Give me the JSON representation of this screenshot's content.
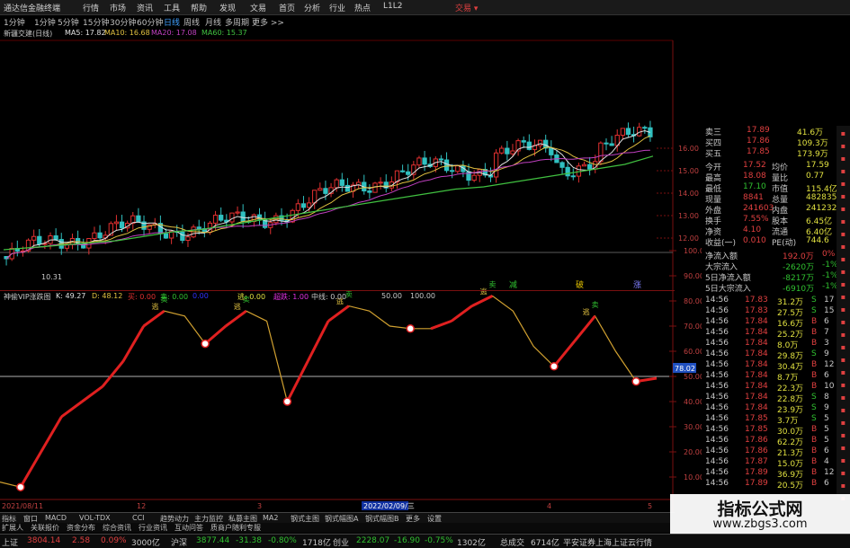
{
  "app": {
    "title": "通达信金融终端",
    "menu": [
      "行情",
      "市场",
      "资讯",
      "工具",
      "帮助",
      "发现",
      "文易",
      "首页",
      "分析",
      "行业",
      "热点",
      "L1L2"
    ],
    "trade_button": "交易 ▾"
  },
  "period_bar": {
    "items": [
      "1分钟",
      "1分钟",
      "5分钟",
      "15分钟",
      "30分钟",
      "60分钟",
      "日线",
      "周线",
      "月线",
      "多周期",
      "更多 >>"
    ],
    "active": "日线"
  },
  "price_chart": {
    "legend": [
      {
        "text": "新疆交建(日线)",
        "color": "#c8c8c8"
      },
      {
        "text": "MA5: 17.82",
        "color": "#e0e0e0"
      },
      {
        "text": "MA10: 16.68",
        "color": "#e0c040"
      },
      {
        "text": "MA20: 17.08",
        "color": "#c040c0"
      },
      {
        "text": "MA60: 15.37",
        "color": "#40c040"
      }
    ],
    "y_ticks": [
      "16.00",
      "15.00",
      "14.00",
      "13.00",
      "12.00"
    ],
    "low_label": "10.31",
    "markers": [
      {
        "label": "减",
        "color": "#30c030"
      },
      {
        "label": "破",
        "color": "#e0c000"
      },
      {
        "label": "涨",
        "color": "#8080ff"
      }
    ]
  },
  "indicator": {
    "legend": [
      {
        "text": "神偷VIP涨跌图",
        "color": "#c8c8c8"
      },
      {
        "text": "K: 49.27",
        "color": "#e0e0e0"
      },
      {
        "text": "D: 48.12",
        "color": "#e0c040"
      },
      {
        "text": "买: 0.00",
        "color": "#e03030"
      },
      {
        "text": "卖: 0.00",
        "color": "#30c030"
      },
      {
        "text": "0.00",
        "color": "#3030ff"
      },
      {
        "text": "逃: 0.00",
        "color": "#e0e040"
      },
      {
        "text": "超跌: 1.00",
        "color": "#e030e0"
      },
      {
        "text": "中线: 0.00",
        "color": "#c8c8c8"
      },
      {
        "text": "50.00",
        "color": "#c8c8c8"
      },
      {
        "text": "100.00",
        "color": "#c8c8c8"
      }
    ],
    "y_ticks": [
      "100.00",
      "90.00",
      "80.00",
      "70.00",
      "60.00",
      "50.00",
      "40.00",
      "30.00",
      "20.00",
      "10.00"
    ],
    "current_value": "78.02",
    "date_axis": [
      "2021/08/11",
      "12",
      "3",
      "2022/02/09/三",
      "4",
      "5"
    ],
    "buy_label": "买",
    "sell_label": "卖",
    "escape_label": "逃"
  },
  "chart_data": [
    {
      "type": "line",
      "title": "新疆交建(日线)",
      "series": [
        {
          "name": "MA60",
          "values": [
            11.2,
            11.3,
            11.4,
            11.5,
            11.6,
            11.8,
            12.0,
            12.1,
            12.3,
            12.5,
            12.7,
            12.9,
            13.1,
            13.3,
            13.5,
            13.7,
            13.9,
            14.0,
            14.2,
            14.4,
            14.6,
            14.8,
            15.0,
            15.37
          ]
        }
      ],
      "ylim": [
        10.0,
        16.8
      ]
    },
    {
      "type": "line",
      "title": "神偷VIP涨跌图",
      "series": [
        {
          "name": "K",
          "values": [
            8,
            6,
            20,
            34,
            40,
            46,
            56,
            70,
            76,
            74,
            63,
            70,
            76,
            72,
            40,
            56,
            72,
            78,
            76,
            70,
            69,
            69,
            72,
            78,
            82,
            76,
            62,
            54,
            64,
            74,
            60,
            48,
            49.27
          ]
        }
      ],
      "ylim": [
        0,
        100
      ]
    }
  ],
  "quote_panel": {
    "orderbook": [
      {
        "label": "卖三",
        "price": "17.89",
        "vol": "41.6万"
      },
      {
        "label": "买四",
        "price": "17.86",
        "vol": "109.3万"
      },
      {
        "label": "买五",
        "price": "17.85",
        "vol": "173.9万"
      }
    ],
    "stats": [
      {
        "l1": "今开",
        "v1": "17.52",
        "l2": "均价",
        "v2": "17.59"
      },
      {
        "l1": "最高",
        "v1": "18.08",
        "l2": "量比",
        "v2": "0.77"
      },
      {
        "l1": "最低",
        "v1": "17.10",
        "l2": "市值",
        "v2": "115.4亿"
      },
      {
        "l1": "现量",
        "v1": "8841",
        "l2": "总量",
        "v2": "482835"
      },
      {
        "l1": "外盘",
        "v1": "241603",
        "l2": "内盘",
        "v2": "241232"
      },
      {
        "l1": "换手",
        "v1": "7.55%",
        "l2": "股本",
        "v2": "6.45亿"
      },
      {
        "l1": "净资",
        "v1": "4.10",
        "l2": "流通",
        "v2": "6.40亿"
      },
      {
        "l1": "收益(一)",
        "v1": "0.010",
        "l2": "PE(动)",
        "v2": "744.6"
      }
    ],
    "flows": [
      {
        "label": "净流入额",
        "value": "192.0万",
        "pct": "0%"
      },
      {
        "label": "大宗流入",
        "value": "-2620万",
        "pct": "-1%"
      },
      {
        "label": "5日净流入额",
        "value": "-8217万",
        "pct": "-1%"
      },
      {
        "label": "5日大宗流入",
        "value": "-6910万",
        "pct": "-1%"
      }
    ],
    "ticks": [
      {
        "t": "14:56",
        "p": "17.83",
        "v": "31.2万",
        "bs": "S",
        "n": "17"
      },
      {
        "t": "14:56",
        "p": "17.83",
        "v": "27.5万",
        "bs": "S",
        "n": "15"
      },
      {
        "t": "14:56",
        "p": "17.84",
        "v": "16.6万",
        "bs": "B",
        "n": "6"
      },
      {
        "t": "14:56",
        "p": "17.84",
        "v": "25.2万",
        "bs": "B",
        "n": "7"
      },
      {
        "t": "14:56",
        "p": "17.84",
        "v": "8.0万",
        "bs": "B",
        "n": "3"
      },
      {
        "t": "14:56",
        "p": "17.84",
        "v": "29.8万",
        "bs": "S",
        "n": "9"
      },
      {
        "t": "14:56",
        "p": "17.84",
        "v": "30.4万",
        "bs": "B",
        "n": "12"
      },
      {
        "t": "14:56",
        "p": "17.84",
        "v": "8.7万",
        "bs": "B",
        "n": "6"
      },
      {
        "t": "14:56",
        "p": "17.84",
        "v": "22.3万",
        "bs": "B",
        "n": "10"
      },
      {
        "t": "14:56",
        "p": "17.84",
        "v": "22.8万",
        "bs": "S",
        "n": "8"
      },
      {
        "t": "14:56",
        "p": "17.84",
        "v": "23.9万",
        "bs": "S",
        "n": "9"
      },
      {
        "t": "14:56",
        "p": "17.85",
        "v": "3.7万",
        "bs": "S",
        "n": "5"
      },
      {
        "t": "14:56",
        "p": "17.85",
        "v": "30.0万",
        "bs": "B",
        "n": "5"
      },
      {
        "t": "14:56",
        "p": "17.86",
        "v": "62.2万",
        "bs": "B",
        "n": "5"
      },
      {
        "t": "14:56",
        "p": "17.86",
        "v": "21.3万",
        "bs": "B",
        "n": "6"
      },
      {
        "t": "14:56",
        "p": "17.87",
        "v": "15.0万",
        "bs": "B",
        "n": "4"
      },
      {
        "t": "14:56",
        "p": "17.89",
        "v": "36.9万",
        "bs": "B",
        "n": "12"
      },
      {
        "t": "14:56",
        "p": "17.89",
        "v": "20.5万",
        "bs": "B",
        "n": "6"
      }
    ]
  },
  "bottom_tabs": [
    "指标",
    "窗口",
    "MACD",
    "VOL-TDX",
    "CCI",
    "趋势动力",
    "主力监控",
    "私募主图",
    "MA2",
    "钢式主图",
    "钢式幅图A",
    "钢式幅图B",
    "更多",
    "设置"
  ],
  "sub_tabs": [
    "扩展人",
    "关联报价",
    "资金分布",
    "综合资讯",
    "行业资讯",
    "互动问答",
    "质商户随利专服"
  ],
  "status_bar": [
    {
      "text": "上证",
      "color": "#c8c8c8"
    },
    {
      "text": "3804.14",
      "color": "#e04040"
    },
    {
      "text": "2.58",
      "color": "#e04040"
    },
    {
      "text": "0.09%",
      "color": "#e04040"
    },
    {
      "text": "3000亿",
      "color": "#c8c8c8"
    },
    {
      "text": "沪深",
      "color": "#c8c8c8"
    },
    {
      "text": "3877.44",
      "color": "#30c030"
    },
    {
      "text": "-31.38",
      "color": "#30c030"
    },
    {
      "text": "-0.80%",
      "color": "#30c030"
    },
    {
      "text": "1718亿",
      "color": "#c8c8c8"
    },
    {
      "text": "创业",
      "color": "#c8c8c8"
    },
    {
      "text": "2228.07",
      "color": "#30c030"
    },
    {
      "text": "-16.90",
      "color": "#30c030"
    },
    {
      "text": "-0.75%",
      "color": "#30c030"
    },
    {
      "text": "1302亿",
      "color": "#c8c8c8"
    },
    {
      "text": "总成交",
      "color": "#c8c8c8"
    },
    {
      "text": "6714亿",
      "color": "#c8c8c8"
    },
    {
      "text": "平安证券上海上证云行情",
      "color": "#c8c8c8"
    }
  ],
  "watermark": {
    "main": "指标公式网",
    "url": "www.zbgs3.com"
  },
  "colors": {
    "up": "#e03030",
    "down": "#30c0c0",
    "ma5": "#e0e0e0",
    "ma10": "#e0c040",
    "ma20": "#c040c0",
    "ma60": "#40c040"
  }
}
